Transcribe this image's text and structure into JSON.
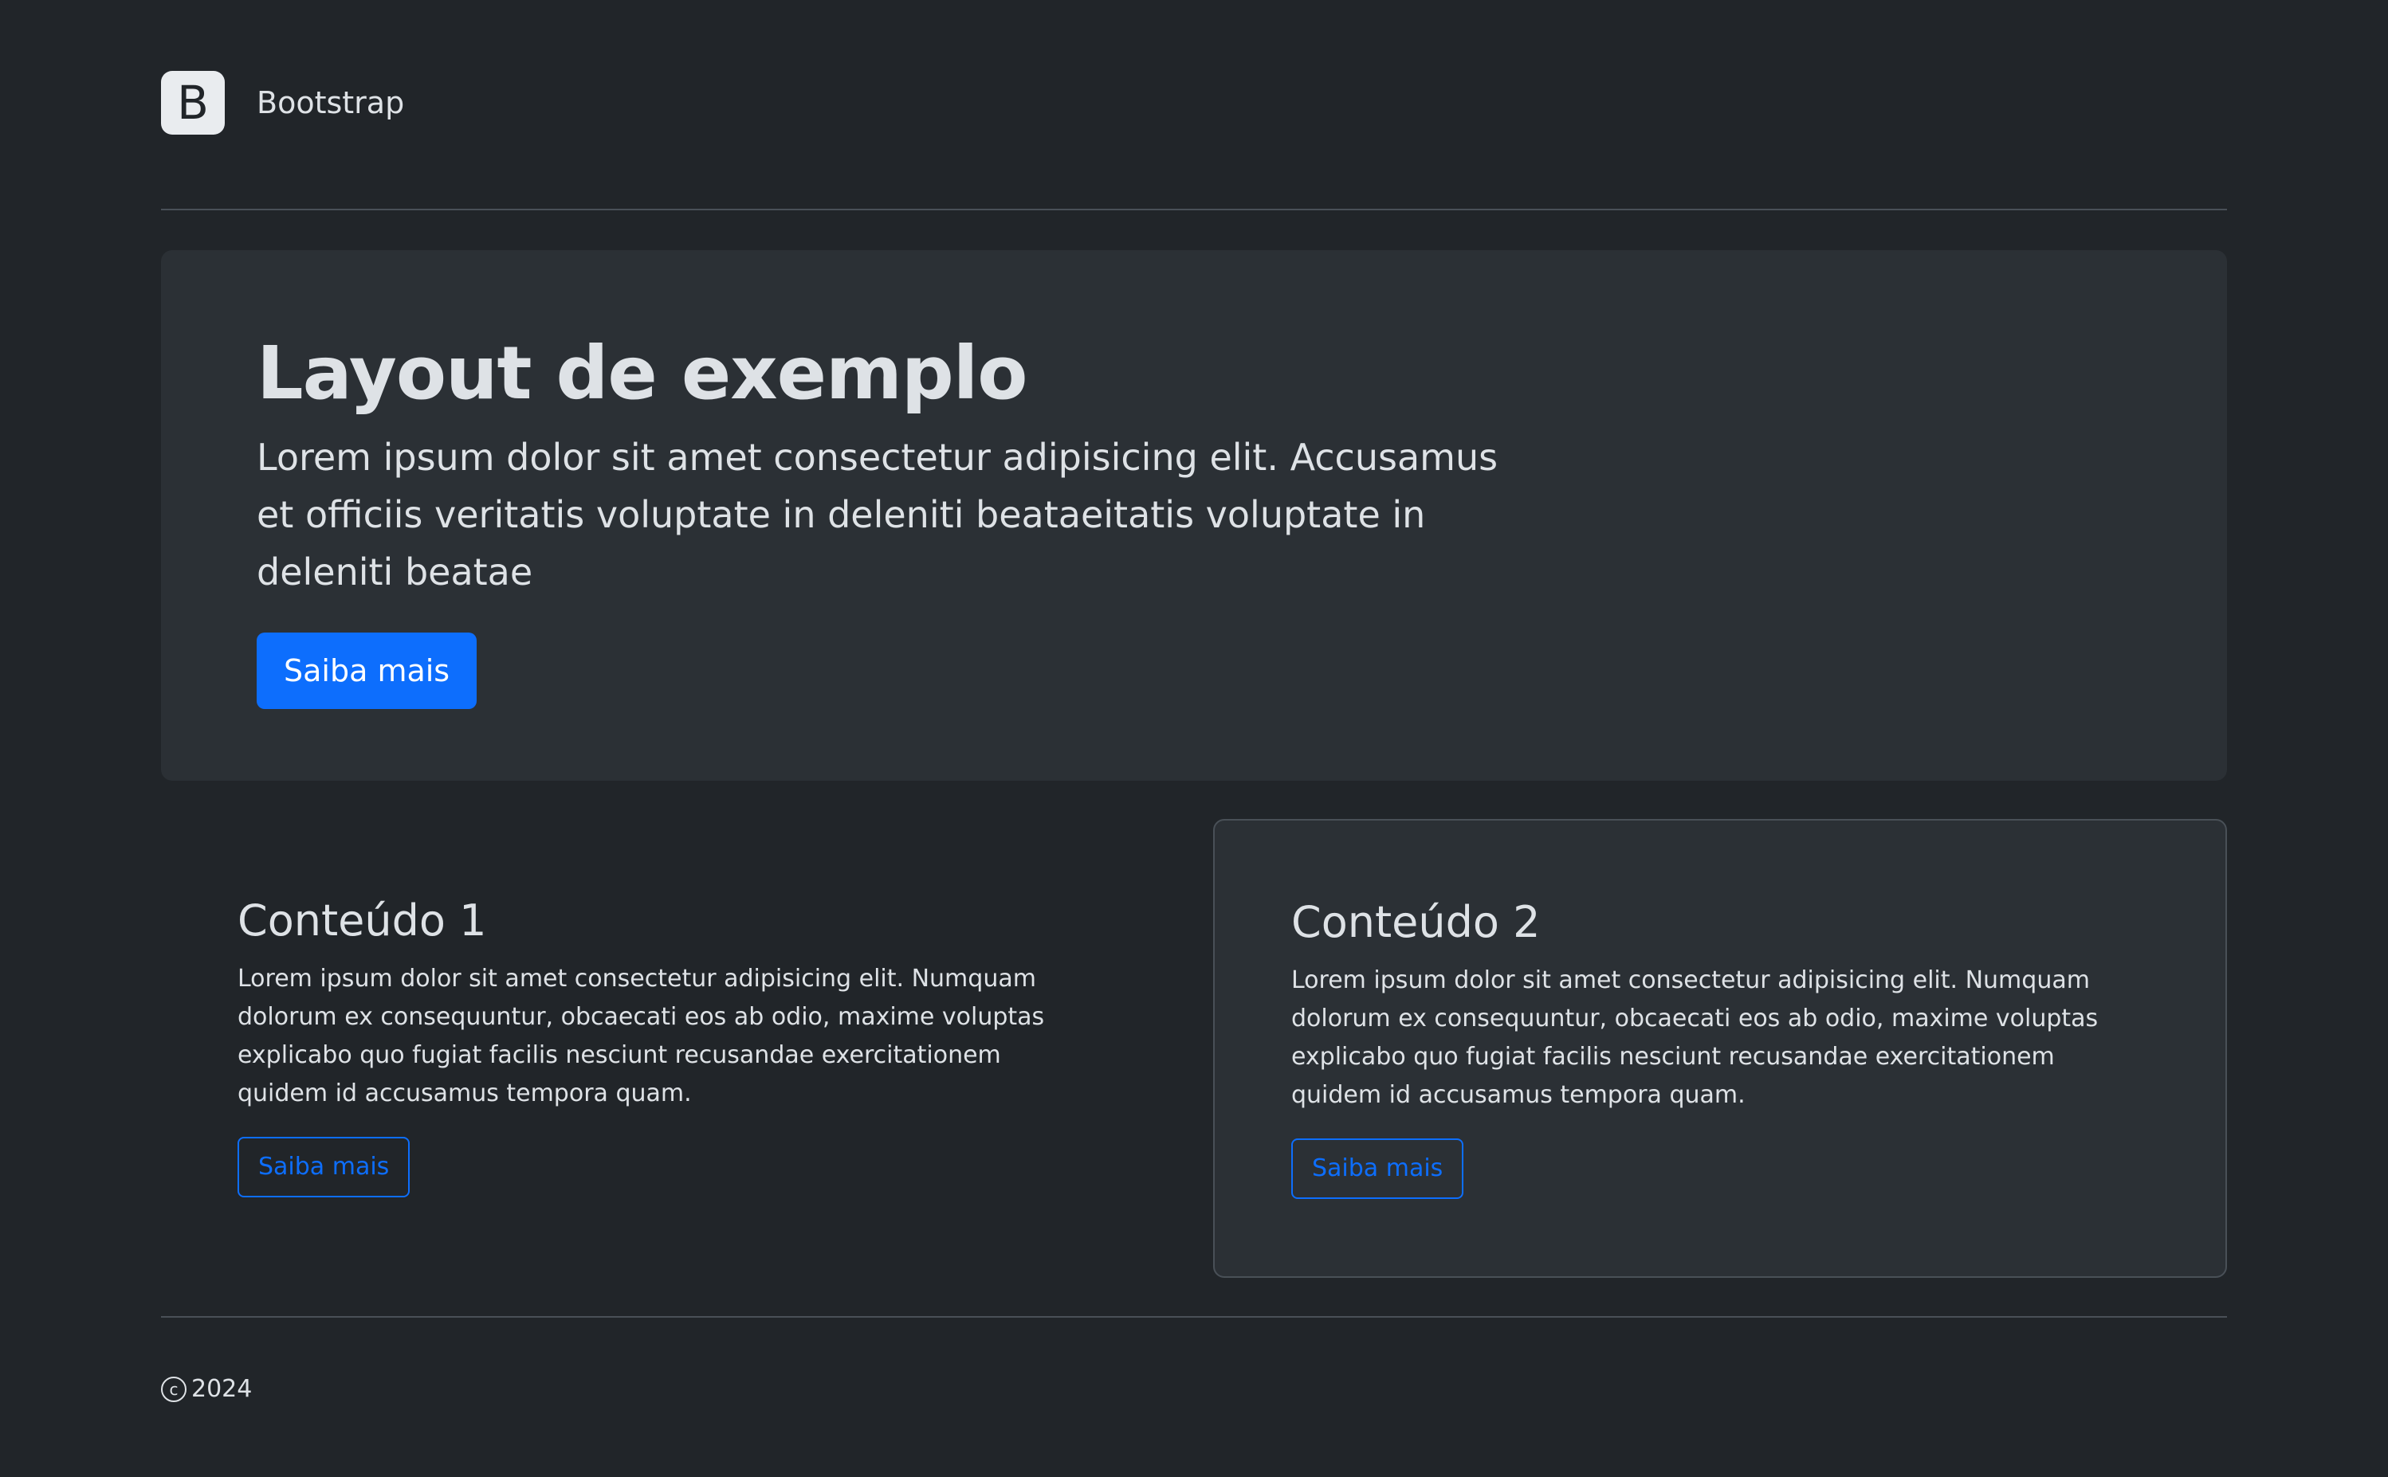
{
  "header": {
    "logo_letter": "B",
    "brand": "Bootstrap"
  },
  "hero": {
    "title": "Layout de exemplo",
    "text": "Lorem ipsum dolor sit amet consectetur adipisicing elit. Accusamus et officiis veritatis voluptate in deleniti beataeitatis voluptate in deleniti beatae",
    "button_label": "Saiba mais"
  },
  "columns": [
    {
      "title": "Conteúdo 1",
      "text": "Lorem ipsum dolor sit amet consectetur adipisicing elit. Numquam dolorum ex consequuntur, obcaecati eos ab odio, maxime voluptas explicabo quo fugiat facilis nesciunt recusandae exercitationem quidem id accusamus tempora quam.",
      "button_label": "Saiba mais"
    },
    {
      "title": "Conteúdo 2",
      "text": "Lorem ipsum dolor sit amet consectetur adipisicing elit. Numquam dolorum ex consequuntur, obcaecati eos ab odio, maxime voluptas explicabo quo fugiat facilis nesciunt recusandae exercitationem quidem id accusamus tempora quam.",
      "button_label": "Saiba mais"
    }
  ],
  "footer": {
    "copyright_icon": "copyright-icon",
    "year": "2024"
  },
  "colors": {
    "background": "#212529",
    "surface": "#2b3035",
    "primary": "#0d6efd",
    "text": "#dee2e6",
    "border": "#495057"
  }
}
